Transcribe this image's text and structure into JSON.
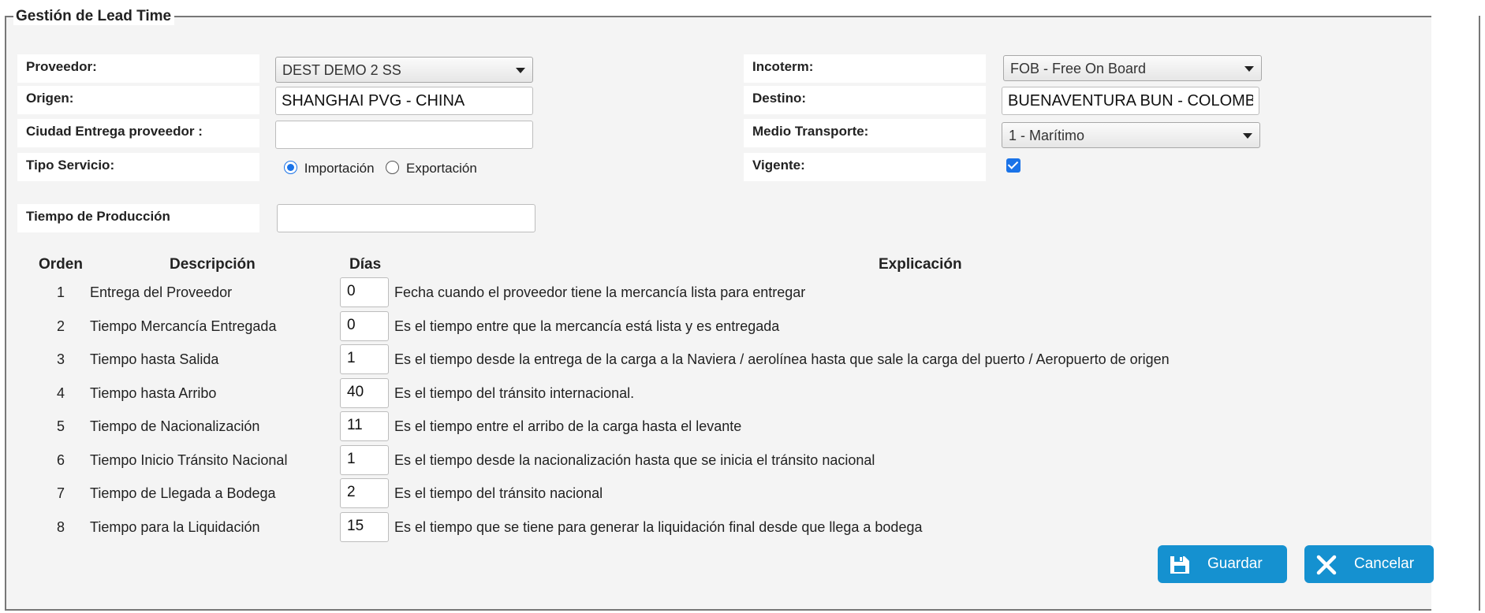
{
  "panel": {
    "title": "Gestión de Lead Time"
  },
  "form": {
    "proveedor": {
      "label": "Proveedor:",
      "value": "DEST DEMO 2 SS"
    },
    "origen": {
      "label": "Origen:",
      "value": "SHANGHAI PVG - CHINA"
    },
    "ciudad_entrega": {
      "label": "Ciudad Entrega proveedor :",
      "value": ""
    },
    "tipo_servicio": {
      "label": "Tipo Servicio:",
      "options": [
        "Importación",
        "Exportación"
      ],
      "selected": "Importación"
    },
    "incoterm": {
      "label": "Incoterm:",
      "value": "FOB - Free On Board"
    },
    "destino": {
      "label": "Destino:",
      "value": "BUENAVENTURA BUN - COLOMBIA"
    },
    "medio_transporte": {
      "label": "Medio Transporte:",
      "value": "1 - Marítimo"
    },
    "vigente": {
      "label": "Vigente:",
      "checked": true
    },
    "tiempo_produccion": {
      "label": "Tiempo de Producción",
      "value": ""
    }
  },
  "table": {
    "headers": {
      "orden": "Orden",
      "descripcion": "Descripción",
      "dias": "Días",
      "explicacion": "Explicación"
    },
    "rows": [
      {
        "orden": "1",
        "descripcion": "Entrega del Proveedor",
        "dias": "0",
        "explicacion": "Fecha cuando el proveedor tiene la mercancía lista para entregar"
      },
      {
        "orden": "2",
        "descripcion": "Tiempo Mercancía Entregada",
        "dias": "0",
        "explicacion": "Es el tiempo entre que la mercancía está lista y es entregada"
      },
      {
        "orden": "3",
        "descripcion": "Tiempo hasta Salida",
        "dias": "1",
        "explicacion": "Es el tiempo desde la entrega de la carga a la Naviera / aerolínea hasta que sale la carga del puerto / Aeropuerto de origen"
      },
      {
        "orden": "4",
        "descripcion": "Tiempo hasta Arribo",
        "dias": "40",
        "explicacion": "Es el tiempo del tránsito internacional."
      },
      {
        "orden": "5",
        "descripcion": "Tiempo de Nacionalización",
        "dias": "11",
        "explicacion": "Es el tiempo entre el arribo de la carga hasta el levante"
      },
      {
        "orden": "6",
        "descripcion": "Tiempo Inicio Tránsito Nacional",
        "dias": "1",
        "explicacion": "Es el tiempo desde la nacionalización hasta que se inicia el tránsito nacional"
      },
      {
        "orden": "7",
        "descripcion": "Tiempo de Llegada a Bodega",
        "dias": "2",
        "explicacion": "Es el tiempo del tránsito nacional"
      },
      {
        "orden": "8",
        "descripcion": "Tiempo para la Liquidación",
        "dias": "15",
        "explicacion": "Es el tiempo que se tiene para generar la liquidación final desde que llega a bodega"
      }
    ]
  },
  "buttons": {
    "guardar": {
      "label": "Guardar",
      "icon": "save-icon"
    },
    "cancelar": {
      "label": "Cancelar",
      "icon": "close-icon"
    }
  },
  "colors": {
    "button": "#1591d0",
    "accent": "#1a73e8"
  }
}
